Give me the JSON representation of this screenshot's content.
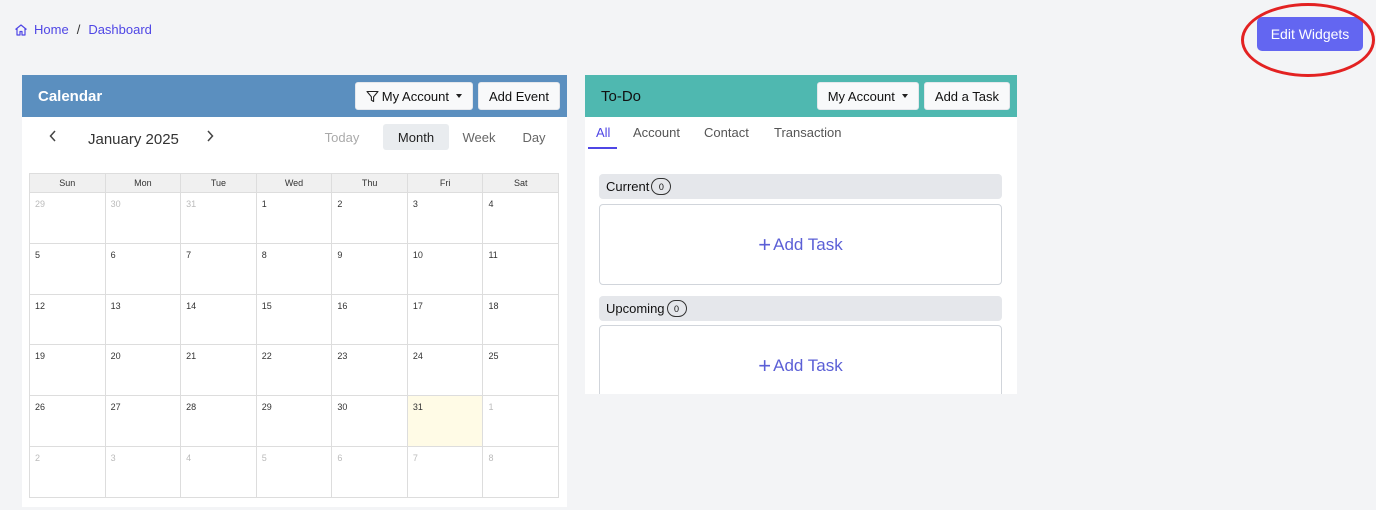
{
  "breadcrumb": {
    "home": "Home",
    "separator": "/",
    "current": "Dashboard"
  },
  "edit_widgets": {
    "label": "Edit Widgets"
  },
  "calendar": {
    "title": "Calendar",
    "account_filter": "My Account",
    "add_event": "Add Event",
    "month_label": "January 2025",
    "views": {
      "today": "Today",
      "month": "Month",
      "week": "Week",
      "day": "Day"
    },
    "weekdays": [
      "Sun",
      "Mon",
      "Tue",
      "Wed",
      "Thu",
      "Fri",
      "Sat"
    ],
    "weeks": [
      [
        "29",
        "30",
        "31",
        "1",
        "2",
        "3",
        "4"
      ],
      [
        "5",
        "6",
        "7",
        "8",
        "9",
        "10",
        "11"
      ],
      [
        "12",
        "13",
        "14",
        "15",
        "16",
        "17",
        "18"
      ],
      [
        "19",
        "20",
        "21",
        "22",
        "23",
        "24",
        "25"
      ],
      [
        "26",
        "27",
        "28",
        "29",
        "30",
        "31",
        "1"
      ],
      [
        "2",
        "3",
        "4",
        "5",
        "6",
        "7",
        "8"
      ]
    ]
  },
  "todo": {
    "title": "To-Do",
    "account_filter": "My Account",
    "add_task_button": "Add a Task",
    "tabs": [
      "All",
      "Account",
      "Contact",
      "Transaction"
    ],
    "current": {
      "label": "Current",
      "count": "0",
      "add_label": "Add Task"
    },
    "upcoming": {
      "label": "Upcoming",
      "count": "0",
      "add_label": "Add Task"
    }
  },
  "colors": {
    "accent": "#6366f1",
    "calendar_header": "#5b8fbf",
    "todo_header": "#4fb8b0",
    "highlight": "#e32222"
  }
}
